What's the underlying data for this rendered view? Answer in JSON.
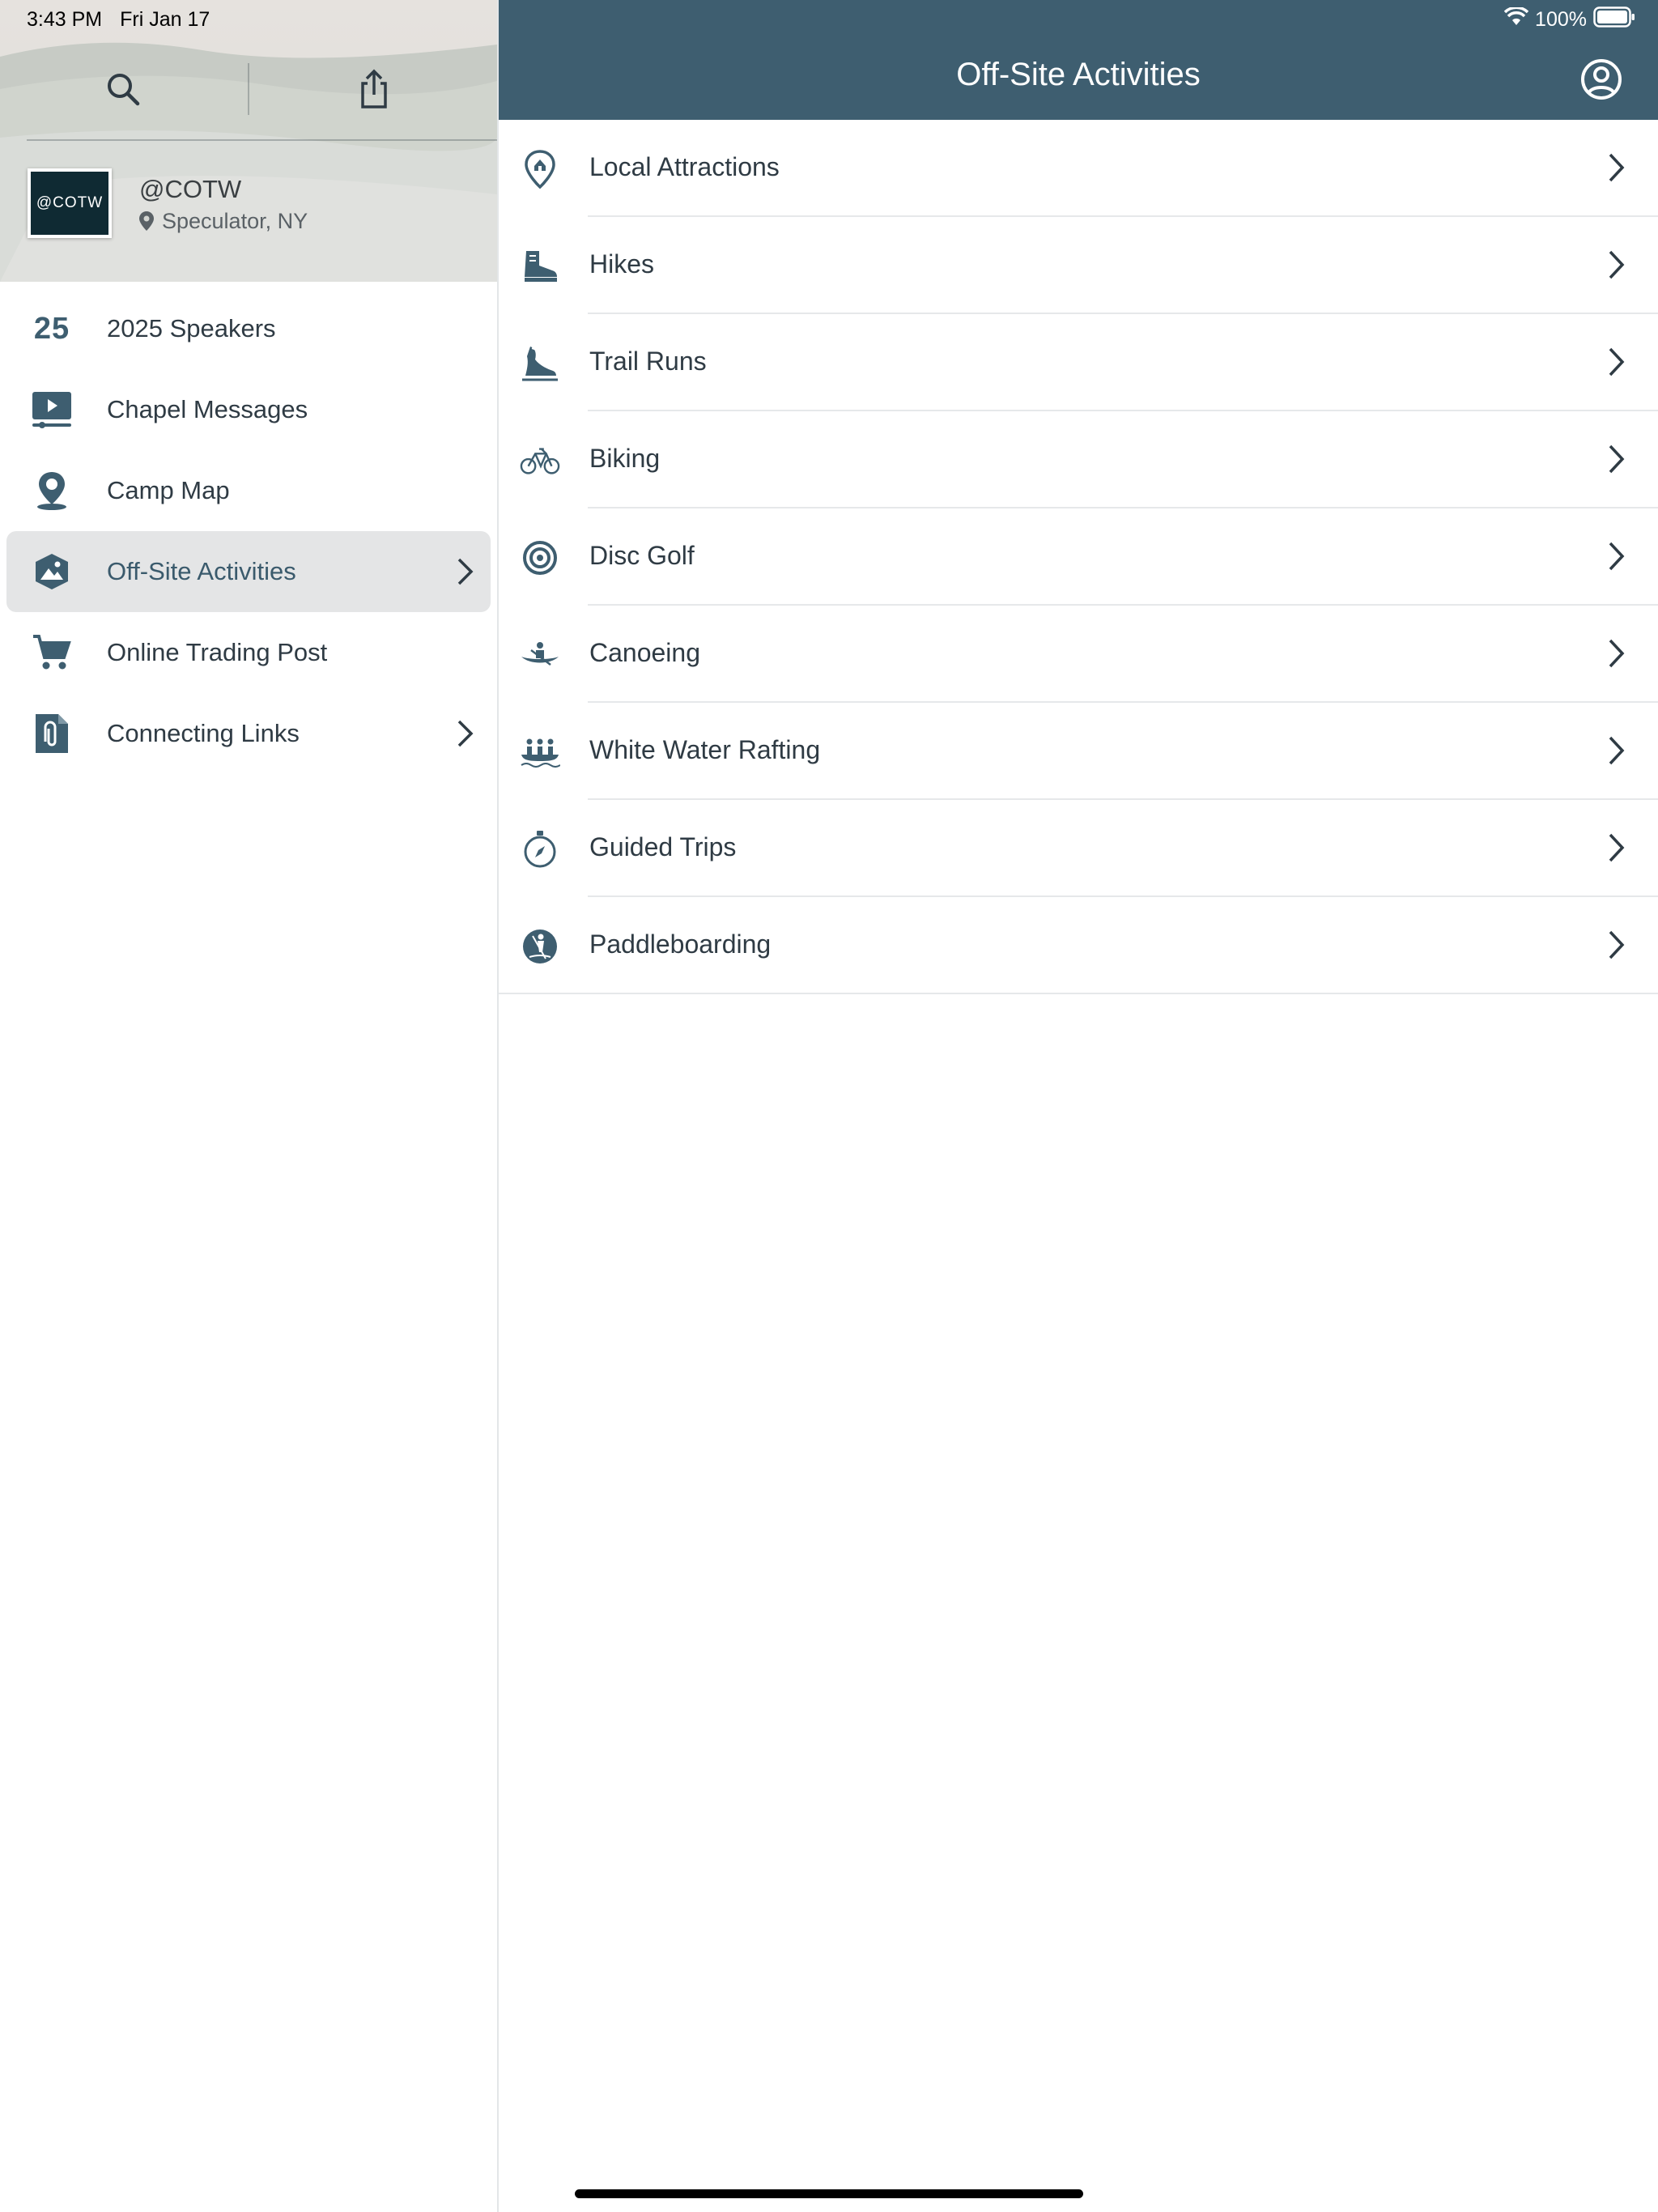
{
  "status_bar": {
    "time": "3:43 PM",
    "date": "Fri Jan 17",
    "battery": "100%"
  },
  "sidebar": {
    "profile": {
      "logo_text": "@COTW",
      "handle": "@COTW",
      "location": "Speculator, NY"
    },
    "items": [
      {
        "label": "2025 Speakers",
        "icon": "number-25-icon",
        "icon_text": "25",
        "chevron": false,
        "active": false
      },
      {
        "label": "Chapel Messages",
        "icon": "video-screen-icon",
        "chevron": false,
        "active": false
      },
      {
        "label": "Camp Map",
        "icon": "location-pin-icon",
        "chevron": false,
        "active": false
      },
      {
        "label": "Off-Site Activities",
        "icon": "mountain-landscape-icon",
        "chevron": true,
        "active": true
      },
      {
        "label": "Online Trading Post",
        "icon": "shopping-cart-icon",
        "chevron": false,
        "active": false
      },
      {
        "label": "Connecting Links",
        "icon": "paperclip-document-icon",
        "chevron": true,
        "active": false
      }
    ]
  },
  "main": {
    "title": "Off-Site Activities",
    "items": [
      {
        "label": "Local Attractions",
        "icon": "map-pin-icon"
      },
      {
        "label": "Hikes",
        "icon": "hiking-boot-icon"
      },
      {
        "label": "Trail Runs",
        "icon": "running-shoe-icon"
      },
      {
        "label": "Biking",
        "icon": "bicycle-icon"
      },
      {
        "label": "Disc Golf",
        "icon": "target-icon"
      },
      {
        "label": "Canoeing",
        "icon": "canoe-icon"
      },
      {
        "label": "White Water Rafting",
        "icon": "rafting-icon"
      },
      {
        "label": "Guided Trips",
        "icon": "compass-icon"
      },
      {
        "label": "Paddleboarding",
        "icon": "paddleboard-icon"
      }
    ]
  },
  "colors": {
    "accent": "#3e5e70",
    "active_bg": "#e4e5e6",
    "text": "#2f3b44"
  }
}
